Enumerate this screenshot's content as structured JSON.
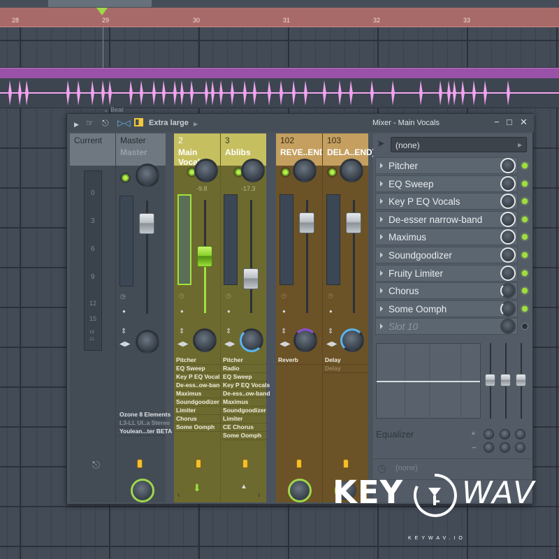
{
  "ruler": {
    "bars": [
      "28",
      "29",
      "30",
      "31",
      "32",
      "33"
    ]
  },
  "playlist": {
    "clip_label": "Beat",
    "clip_color": "#9a52a8",
    "wave_color": "#f2a4f0"
  },
  "toolbar": {
    "size_label": "Extra large",
    "title": "Mixer - Main Vocals",
    "minimize": "−",
    "maximize": "□",
    "close": "✕"
  },
  "strips": [
    {
      "label_top": "Current",
      "label": "",
      "number": ""
    },
    {
      "number": "",
      "label_top": "Master",
      "label": "Master",
      "fx": [
        "Ozone 8 Elements",
        "L3-LL Ul..a Stereo",
        "Youlean...ter BETA"
      ]
    },
    {
      "number": "2",
      "label": "Main Vocals",
      "volume": "-9.8",
      "fx": [
        "Pitcher",
        "EQ Sweep",
        "Key P EQ Vocals",
        "De-ess..ow-band",
        "Maximus",
        "Soundgoodizer",
        "Limiter",
        "Chorus",
        "Some Oomph"
      ]
    },
    {
      "number": "3",
      "label": "Ablibs",
      "volume": "-17.3",
      "fx": [
        "Pitcher",
        "Radio",
        "EQ Sweep",
        "Key P EQ Vocals",
        "De-ess..ow-band",
        "Maximus",
        "Soundgoodizer",
        "Limiter",
        "CE Chorus",
        "Some Oomph"
      ]
    },
    {
      "number": "102",
      "label": "REVE..END)",
      "fx": [
        "Reverb"
      ]
    },
    {
      "number": "103",
      "label": "DELA..END)",
      "fx": [
        "Delay",
        "Delay"
      ]
    }
  ],
  "meter_scale": [
    "0",
    "3",
    "6",
    "9",
    "12",
    "15",
    "18",
    "21"
  ],
  "panel": {
    "input": "(none)",
    "slots": [
      "Pitcher",
      "EQ Sweep",
      "Key P EQ Vocals",
      "De-esser narrow-band",
      "Maximus",
      "Soundgoodizer",
      "Fruity Limiter",
      "Chorus",
      "Some Oomph",
      "Slot 10"
    ],
    "eq_label": "Equalizer",
    "output": "(none)"
  },
  "watermark": {
    "brand_bold": "KEY",
    "brand_light": "WAV",
    "sub": "KEYWAV.IO"
  }
}
